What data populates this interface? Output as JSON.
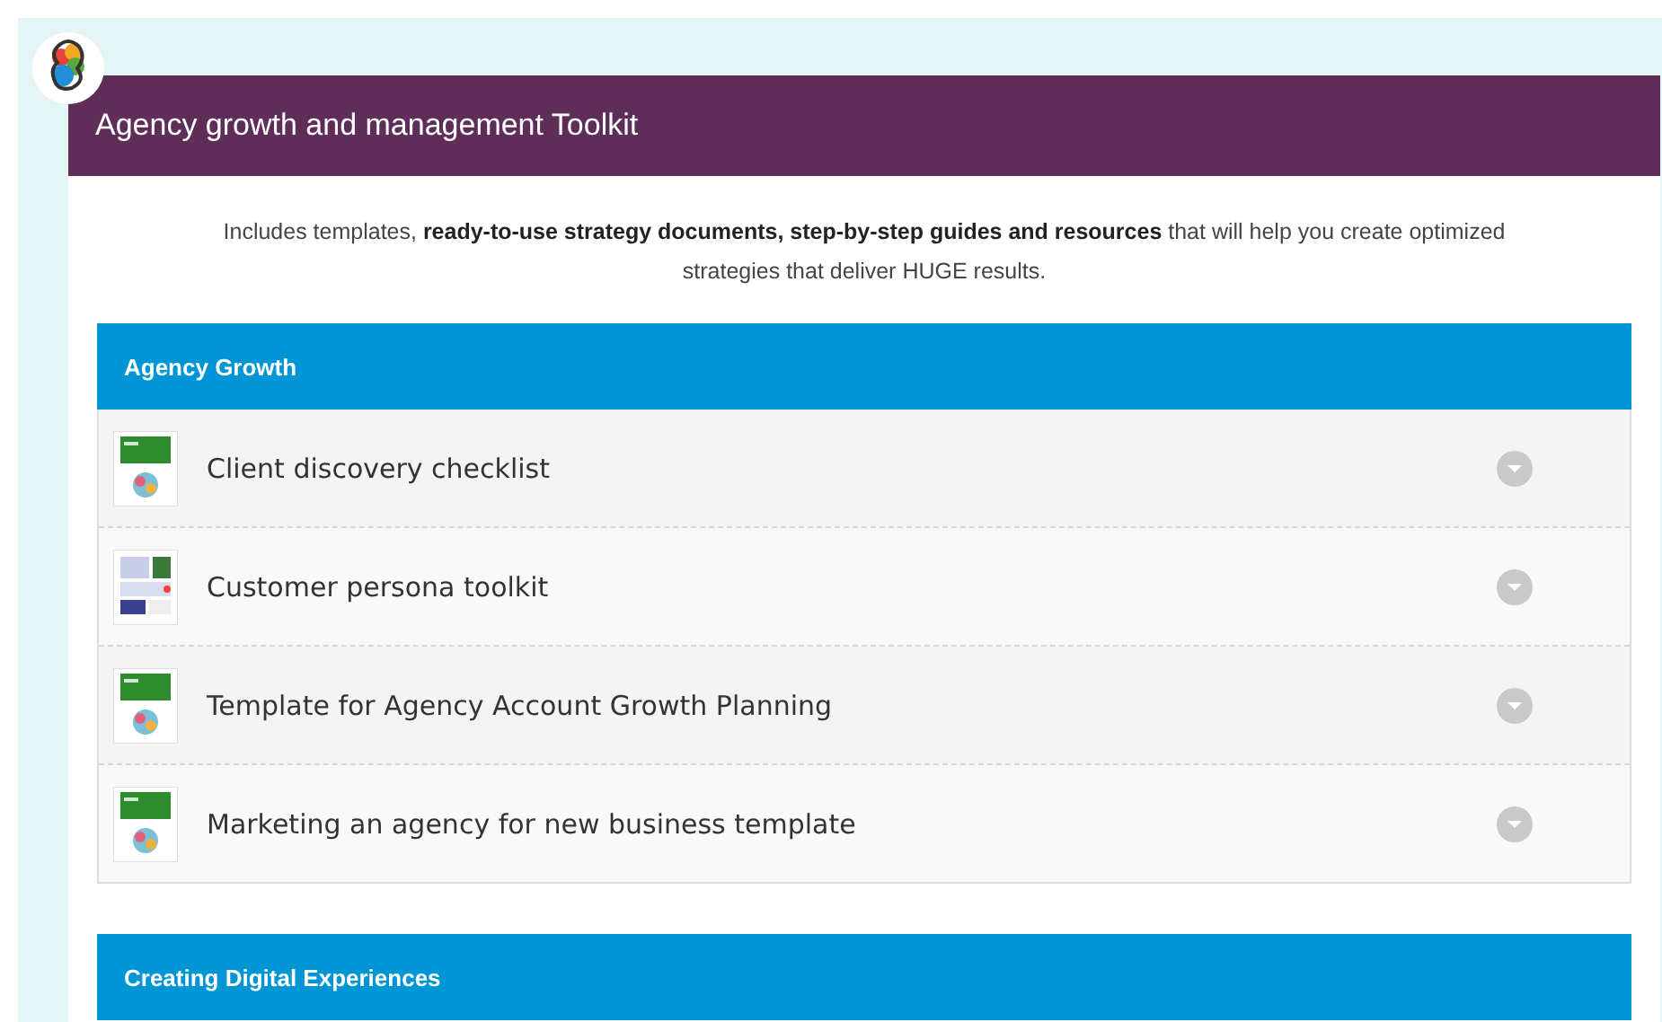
{
  "toolkit": {
    "title": "Agency growth and management Toolkit",
    "description": "Includes templates, **ready-to-use strategy documents, step-by-step guides and resources** that will help you create optimized strategies that deliver HUGE results."
  },
  "sections": [
    {
      "title": "Agency Growth",
      "items": [
        {
          "label": "Client discovery checklist",
          "kind": "cover"
        },
        {
          "label": "Customer persona toolkit",
          "kind": "sheets"
        },
        {
          "label": "Template for Agency Account Growth Planning",
          "kind": "cover"
        },
        {
          "label": "Marketing an agency for new business template",
          "kind": "cover"
        }
      ]
    },
    {
      "title": "Creating Digital Experiences"
    }
  ]
}
